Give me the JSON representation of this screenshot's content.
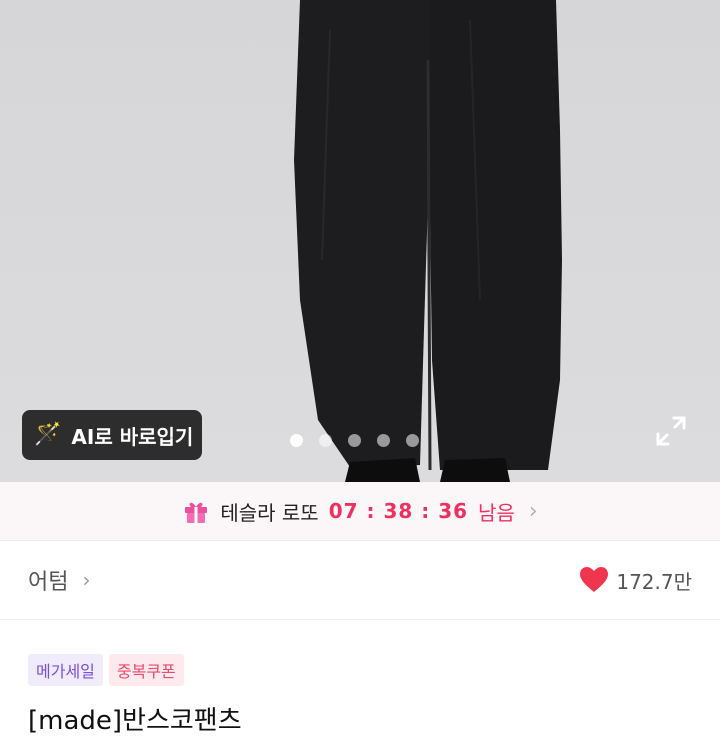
{
  "hero": {
    "ai_button_label": "AI로 바로입기",
    "ai_icon": "magic-wand-icon",
    "carousel_dots": 5,
    "carousel_active_index": 0,
    "expand_icon": "expand-icon"
  },
  "promo": {
    "icon": "gift-icon",
    "label": "테슬라 로또",
    "timer": "07 : 38 : 36",
    "suffix": "남음",
    "chevron": "›"
  },
  "store": {
    "name": "어텀",
    "chevron": "›",
    "likes": "172.7만",
    "heart_color": "#f0364f"
  },
  "badges": [
    "메가세일",
    "중복쿠폰"
  ],
  "product": {
    "title": "[made]반스코팬츠"
  }
}
